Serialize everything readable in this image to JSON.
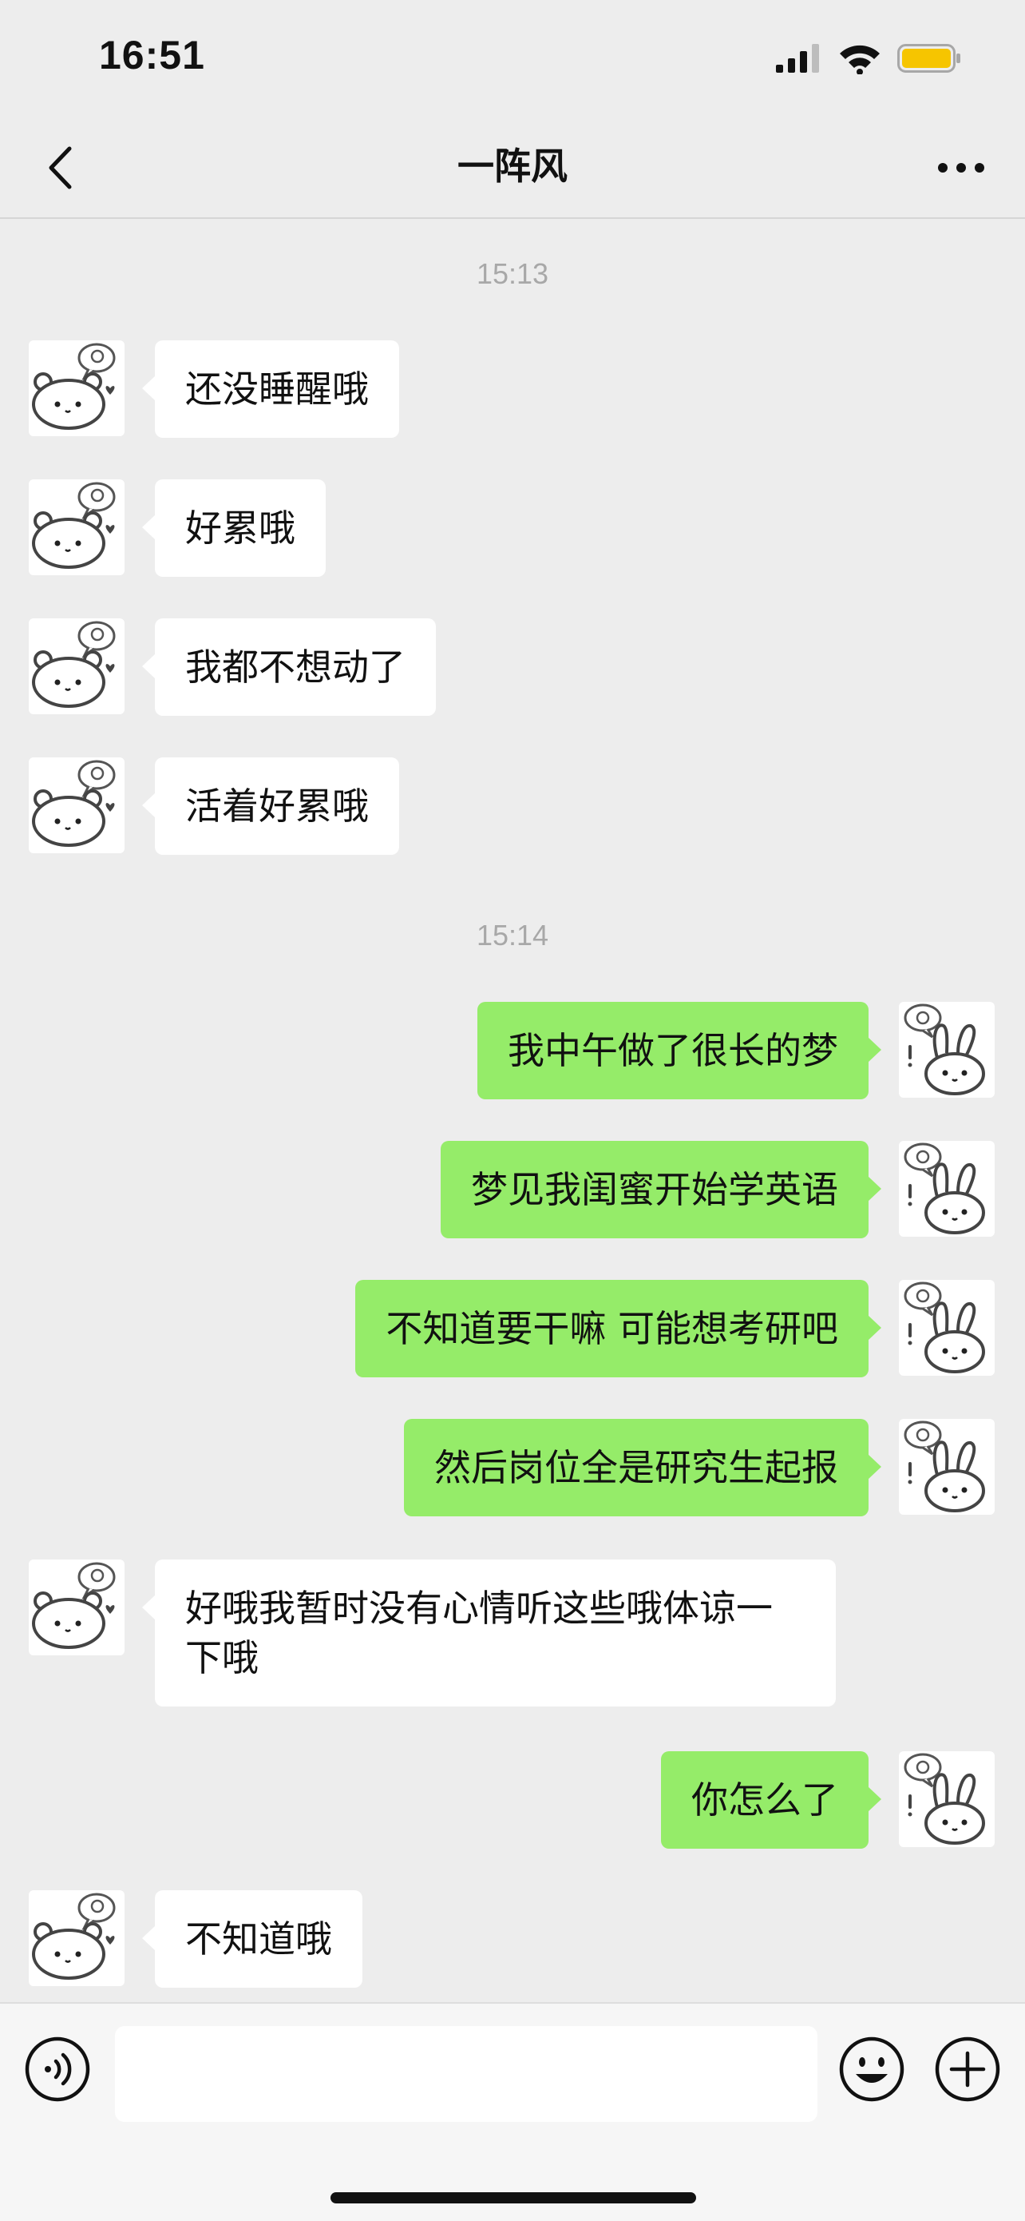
{
  "status": {
    "time": "16:51"
  },
  "nav": {
    "title": "一阵风"
  },
  "messages": [
    {
      "type": "time",
      "text": "15:13"
    },
    {
      "type": "in",
      "text": "还没睡醒哦"
    },
    {
      "type": "in",
      "text": "好累哦"
    },
    {
      "type": "in",
      "text": "我都不想动了"
    },
    {
      "type": "in",
      "text": "活着好累哦"
    },
    {
      "type": "time",
      "text": "15:14"
    },
    {
      "type": "out",
      "text": "我中午做了很长的梦"
    },
    {
      "type": "out",
      "text": "梦见我闺蜜开始学英语"
    },
    {
      "type": "out",
      "text": "不知道要干嘛 可能想考研吧"
    },
    {
      "type": "out",
      "text": "然后岗位全是研究生起报"
    },
    {
      "type": "in",
      "text": "好哦我暂时没有心情听这些哦体谅一下哦"
    },
    {
      "type": "out",
      "text": "你怎么了"
    },
    {
      "type": "in",
      "text": "不知道哦"
    }
  ],
  "input": {
    "placeholder": ""
  },
  "icons": {
    "back": "chevron-left-icon",
    "more": "more-dots-icon",
    "voice": "voice-icon",
    "emoji": "emoji-icon",
    "plus": "plus-icon",
    "friend_avatar": "bear-avatar",
    "my_avatar": "bunny-avatar"
  },
  "colors": {
    "background": "#ededed",
    "outgoing_bubble": "#95ec69",
    "incoming_bubble": "#ffffff"
  }
}
